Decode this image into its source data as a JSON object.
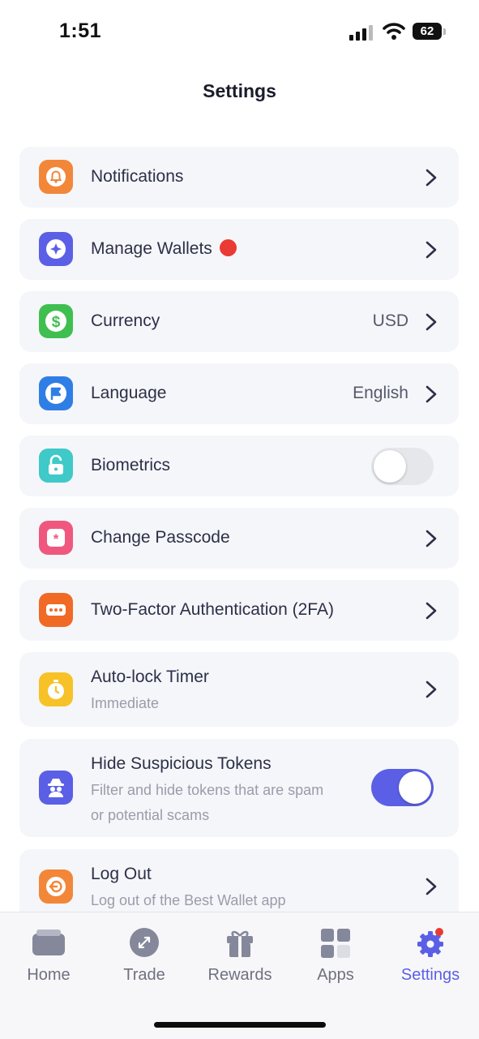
{
  "status_bar": {
    "time": "1:51",
    "battery": "62"
  },
  "page": {
    "title": "Settings"
  },
  "rows": {
    "notifications": {
      "label": "Notifications",
      "icon": "bell-icon",
      "color": "#f2873a"
    },
    "manage_wallets": {
      "label": "Manage Wallets",
      "icon": "wallet-icon",
      "color": "#5b5fe6",
      "badge": "red-dot"
    },
    "currency": {
      "label": "Currency",
      "value": "USD",
      "icon": "dollar-icon",
      "color": "#3fbf4f"
    },
    "language": {
      "label": "Language",
      "value": "English",
      "icon": "flag-icon",
      "color": "#2f7ee6"
    },
    "biometrics": {
      "label": "Biometrics",
      "icon": "unlock-icon",
      "color": "#3fc9c9",
      "enabled": false
    },
    "change_passcode": {
      "label": "Change Passcode",
      "icon": "asterisk-icon",
      "color": "#f0577f"
    },
    "two_factor": {
      "label": "Two-Factor Authentication (2FA)",
      "icon": "dots-icon",
      "color": "#f06a26"
    },
    "auto_lock": {
      "label": "Auto-lock Timer",
      "sub": "Immediate",
      "icon": "timer-icon",
      "color": "#f7c227"
    },
    "hide_suspicious": {
      "label": "Hide Suspicious Tokens",
      "sub1": "Filter and hide tokens that are spam",
      "sub2": "or potential scams",
      "icon": "spy-icon",
      "color": "#5b5fe6",
      "enabled": true
    },
    "log_out": {
      "label": "Log Out",
      "sub": "Log out of the Best Wallet app",
      "icon": "logout-icon",
      "color": "#f2873a"
    }
  },
  "tabs": [
    {
      "label": "Home",
      "icon": "card-icon",
      "active": false
    },
    {
      "label": "Trade",
      "icon": "arrows-icon",
      "active": false
    },
    {
      "label": "Rewards",
      "icon": "gift-icon",
      "active": false
    },
    {
      "label": "Apps",
      "icon": "grid-icon",
      "active": false
    },
    {
      "label": "Settings",
      "icon": "gear-icon",
      "active": true
    }
  ],
  "colors": {
    "accent": "#5b5fe6",
    "row_bg": "#f5f6f9",
    "badge": "#ea3a35"
  }
}
